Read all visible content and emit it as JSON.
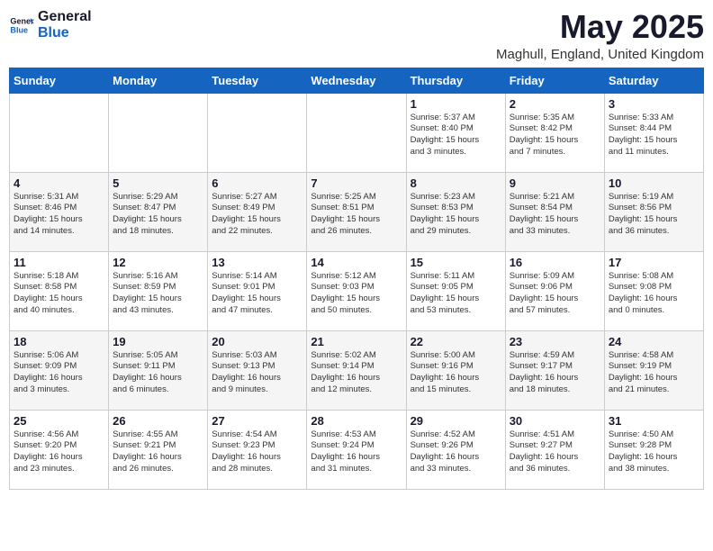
{
  "header": {
    "logo_general": "General",
    "logo_blue": "Blue",
    "month_title": "May 2025",
    "location": "Maghull, England, United Kingdom"
  },
  "days_of_week": [
    "Sunday",
    "Monday",
    "Tuesday",
    "Wednesday",
    "Thursday",
    "Friday",
    "Saturday"
  ],
  "weeks": [
    [
      {
        "day": "",
        "info": ""
      },
      {
        "day": "",
        "info": ""
      },
      {
        "day": "",
        "info": ""
      },
      {
        "day": "",
        "info": ""
      },
      {
        "day": "1",
        "info": "Sunrise: 5:37 AM\nSunset: 8:40 PM\nDaylight: 15 hours\nand 3 minutes."
      },
      {
        "day": "2",
        "info": "Sunrise: 5:35 AM\nSunset: 8:42 PM\nDaylight: 15 hours\nand 7 minutes."
      },
      {
        "day": "3",
        "info": "Sunrise: 5:33 AM\nSunset: 8:44 PM\nDaylight: 15 hours\nand 11 minutes."
      }
    ],
    [
      {
        "day": "4",
        "info": "Sunrise: 5:31 AM\nSunset: 8:46 PM\nDaylight: 15 hours\nand 14 minutes."
      },
      {
        "day": "5",
        "info": "Sunrise: 5:29 AM\nSunset: 8:47 PM\nDaylight: 15 hours\nand 18 minutes."
      },
      {
        "day": "6",
        "info": "Sunrise: 5:27 AM\nSunset: 8:49 PM\nDaylight: 15 hours\nand 22 minutes."
      },
      {
        "day": "7",
        "info": "Sunrise: 5:25 AM\nSunset: 8:51 PM\nDaylight: 15 hours\nand 26 minutes."
      },
      {
        "day": "8",
        "info": "Sunrise: 5:23 AM\nSunset: 8:53 PM\nDaylight: 15 hours\nand 29 minutes."
      },
      {
        "day": "9",
        "info": "Sunrise: 5:21 AM\nSunset: 8:54 PM\nDaylight: 15 hours\nand 33 minutes."
      },
      {
        "day": "10",
        "info": "Sunrise: 5:19 AM\nSunset: 8:56 PM\nDaylight: 15 hours\nand 36 minutes."
      }
    ],
    [
      {
        "day": "11",
        "info": "Sunrise: 5:18 AM\nSunset: 8:58 PM\nDaylight: 15 hours\nand 40 minutes."
      },
      {
        "day": "12",
        "info": "Sunrise: 5:16 AM\nSunset: 8:59 PM\nDaylight: 15 hours\nand 43 minutes."
      },
      {
        "day": "13",
        "info": "Sunrise: 5:14 AM\nSunset: 9:01 PM\nDaylight: 15 hours\nand 47 minutes."
      },
      {
        "day": "14",
        "info": "Sunrise: 5:12 AM\nSunset: 9:03 PM\nDaylight: 15 hours\nand 50 minutes."
      },
      {
        "day": "15",
        "info": "Sunrise: 5:11 AM\nSunset: 9:05 PM\nDaylight: 15 hours\nand 53 minutes."
      },
      {
        "day": "16",
        "info": "Sunrise: 5:09 AM\nSunset: 9:06 PM\nDaylight: 15 hours\nand 57 minutes."
      },
      {
        "day": "17",
        "info": "Sunrise: 5:08 AM\nSunset: 9:08 PM\nDaylight: 16 hours\nand 0 minutes."
      }
    ],
    [
      {
        "day": "18",
        "info": "Sunrise: 5:06 AM\nSunset: 9:09 PM\nDaylight: 16 hours\nand 3 minutes."
      },
      {
        "day": "19",
        "info": "Sunrise: 5:05 AM\nSunset: 9:11 PM\nDaylight: 16 hours\nand 6 minutes."
      },
      {
        "day": "20",
        "info": "Sunrise: 5:03 AM\nSunset: 9:13 PM\nDaylight: 16 hours\nand 9 minutes."
      },
      {
        "day": "21",
        "info": "Sunrise: 5:02 AM\nSunset: 9:14 PM\nDaylight: 16 hours\nand 12 minutes."
      },
      {
        "day": "22",
        "info": "Sunrise: 5:00 AM\nSunset: 9:16 PM\nDaylight: 16 hours\nand 15 minutes."
      },
      {
        "day": "23",
        "info": "Sunrise: 4:59 AM\nSunset: 9:17 PM\nDaylight: 16 hours\nand 18 minutes."
      },
      {
        "day": "24",
        "info": "Sunrise: 4:58 AM\nSunset: 9:19 PM\nDaylight: 16 hours\nand 21 minutes."
      }
    ],
    [
      {
        "day": "25",
        "info": "Sunrise: 4:56 AM\nSunset: 9:20 PM\nDaylight: 16 hours\nand 23 minutes."
      },
      {
        "day": "26",
        "info": "Sunrise: 4:55 AM\nSunset: 9:21 PM\nDaylight: 16 hours\nand 26 minutes."
      },
      {
        "day": "27",
        "info": "Sunrise: 4:54 AM\nSunset: 9:23 PM\nDaylight: 16 hours\nand 28 minutes."
      },
      {
        "day": "28",
        "info": "Sunrise: 4:53 AM\nSunset: 9:24 PM\nDaylight: 16 hours\nand 31 minutes."
      },
      {
        "day": "29",
        "info": "Sunrise: 4:52 AM\nSunset: 9:26 PM\nDaylight: 16 hours\nand 33 minutes."
      },
      {
        "day": "30",
        "info": "Sunrise: 4:51 AM\nSunset: 9:27 PM\nDaylight: 16 hours\nand 36 minutes."
      },
      {
        "day": "31",
        "info": "Sunrise: 4:50 AM\nSunset: 9:28 PM\nDaylight: 16 hours\nand 38 minutes."
      }
    ]
  ]
}
